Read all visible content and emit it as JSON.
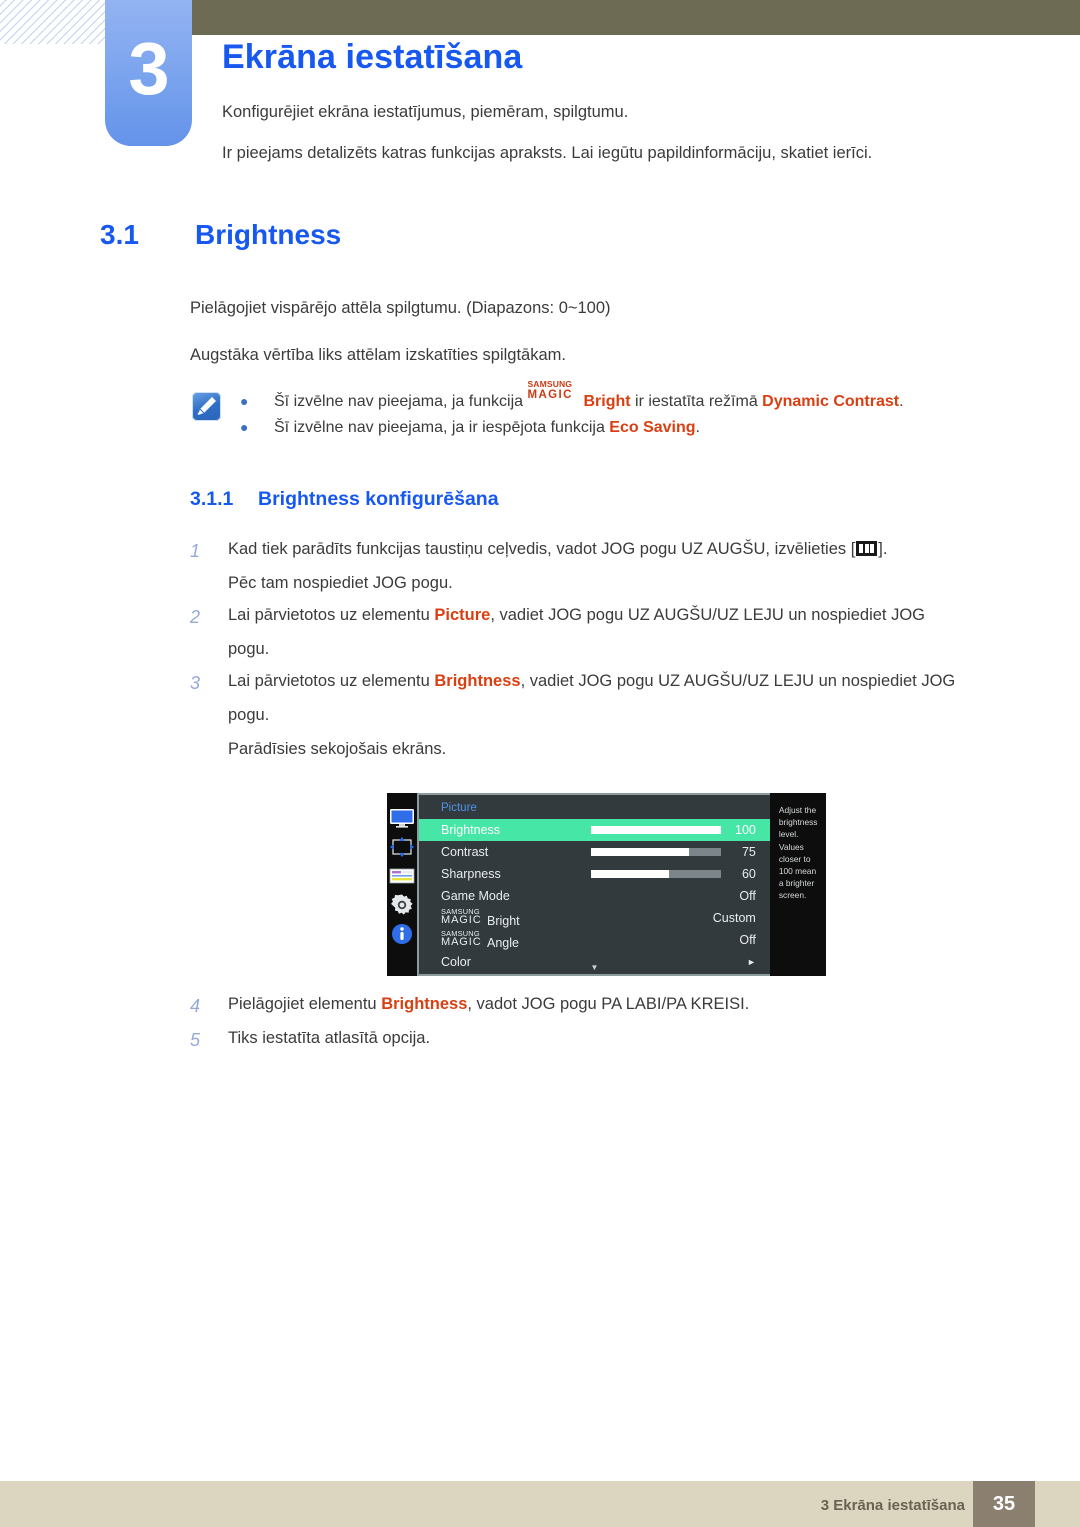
{
  "header": {
    "chapter_number": "3",
    "chapter_title": "Ekrāna iestatīšana",
    "sub1": "Konfigurējiet ekrāna iestatījumus, piemēram, spilgtumu.",
    "sub2": "Ir pieejams detalizēts katras funkcijas apraksts. Lai iegūtu papildinformāciju, skatiet ierīci."
  },
  "section": {
    "number": "3.1",
    "title": "Brightness",
    "para1": "Pielāgojiet vispārējo attēla spilgtumu. (Diapazons: 0~100)",
    "para2": "Augstāka vērtība liks attēlam izskatīties spilgtākam."
  },
  "note": {
    "icon": "note-pen-icon",
    "bullet1": {
      "pre": "Šī izvēlne nav pieejama, ja funkcija ",
      "magic_top": "SAMSUNG",
      "magic_bottom": "MAGIC",
      "magic_suffix": "Bright",
      "mid": " ir iestatīta režīmā ",
      "highlight": "Dynamic Contrast",
      "post": "."
    },
    "bullet2": {
      "pre": "Šī izvēlne nav pieejama, ja ir iespējota funkcija ",
      "highlight": "Eco Saving",
      "post": "."
    }
  },
  "subsection": {
    "number": "3.1.1",
    "title": "Brightness konfigurēšana"
  },
  "steps": [
    {
      "n": "1",
      "lines": [
        {
          "pre": "Kad tiek parādīts funkcijas taustiņu ceļvedis, vadot JOG pogu UZ AUGŠU, izvēlieties [",
          "glyph": "menu-icon",
          "post": "]."
        },
        {
          "text": "Pēc tam nospiediet JOG pogu."
        }
      ]
    },
    {
      "n": "2",
      "lines": [
        {
          "pre": "Lai pārvietotos uz elementu ",
          "highlight": "Picture",
          "post": ", vadiet JOG pogu UZ AUGŠU/UZ LEJU un nospiediet JOG"
        },
        {
          "text": "pogu."
        }
      ]
    },
    {
      "n": "3",
      "lines": [
        {
          "pre": "Lai pārvietotos uz elementu ",
          "highlight": "Brightness",
          "post": ", vadiet JOG pogu UZ AUGŠU/UZ LEJU un nospiediet JOG"
        },
        {
          "text": "pogu."
        },
        {
          "text": "Parādīsies sekojošais ekrāns."
        }
      ]
    }
  ],
  "steps_late": [
    {
      "n": "4",
      "pre": "Pielāgojiet elementu ",
      "highlight": "Brightness",
      "post": ", vadot JOG pogu PA LABI/PA KREISI."
    },
    {
      "n": "5",
      "text": "Tiks iestatīta atlasītā opcija."
    }
  ],
  "osd": {
    "title": "Picture",
    "sidebar_icons": [
      "monitor-icon",
      "move-arrows-icon",
      "osd-panel-icon",
      "gear-icon",
      "info-icon"
    ],
    "rows": [
      {
        "label": "Brightness",
        "value": "100",
        "bar": 100,
        "selected": true
      },
      {
        "label": "Contrast",
        "value": "75",
        "bar": 75,
        "selected": false
      },
      {
        "label": "Sharpness",
        "value": "60",
        "bar": 60,
        "selected": false
      },
      {
        "label": "Game Mode",
        "value": "Off",
        "selected": false
      },
      {
        "magic_top": "SAMSUNG",
        "magic_bottom": "MAGIC",
        "magic_suffix": "Bright",
        "value": "Custom",
        "selected": false
      },
      {
        "magic_top": "SAMSUNG",
        "magic_bottom": "MAGIC",
        "magic_suffix": "Angle",
        "value": "Off",
        "selected": false
      },
      {
        "label": "Color",
        "arrow": "►",
        "selected": false
      }
    ],
    "scroll_glyph": "▼",
    "help_text": "Adjust the brightness level. Values closer to 100 mean a brighter screen.",
    "selected_color": "#46e6a7",
    "title_color": "#4f93e8"
  },
  "footer": {
    "text": "3 Ekrāna iestatīšana",
    "page": "35"
  }
}
